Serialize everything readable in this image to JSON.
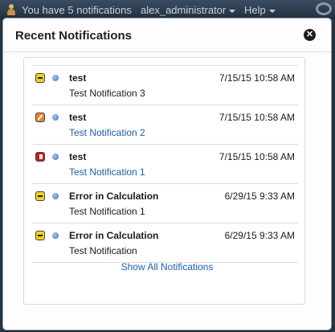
{
  "topbar": {
    "notifications_text": "You have 5 notifications",
    "user_menu": "alex_administrator",
    "help_menu": "Help"
  },
  "popup": {
    "title": "Recent Notifications",
    "close_icon": "close-icon",
    "show_all": "Show All Notifications"
  },
  "notifications": [
    {
      "icon": "minus-icon",
      "title": "test",
      "time": "7/15/15 10:58 AM",
      "body": "Test Notification 3",
      "body_is_link": false
    },
    {
      "icon": "edit-icon",
      "title": "test",
      "time": "7/15/15 10:58 AM",
      "body": "Test Notification 2",
      "body_is_link": true
    },
    {
      "icon": "alert-icon",
      "title": "test",
      "time": "7/15/15 10:58 AM",
      "body": "Test Notification 1",
      "body_is_link": true
    },
    {
      "icon": "minus-icon",
      "title": "Error in Calculation",
      "time": "6/29/15 9:33 AM",
      "body": "Test Notification 1",
      "body_is_link": false
    },
    {
      "icon": "minus-icon",
      "title": "Error in Calculation",
      "time": "6/29/15 9:33 AM",
      "body": "Test Notification",
      "body_is_link": false
    }
  ],
  "colors": {
    "link": "#1f5fa8",
    "priority_low": "#f3d21c",
    "priority_medium": "#e8822a",
    "priority_high": "#c8191e"
  }
}
